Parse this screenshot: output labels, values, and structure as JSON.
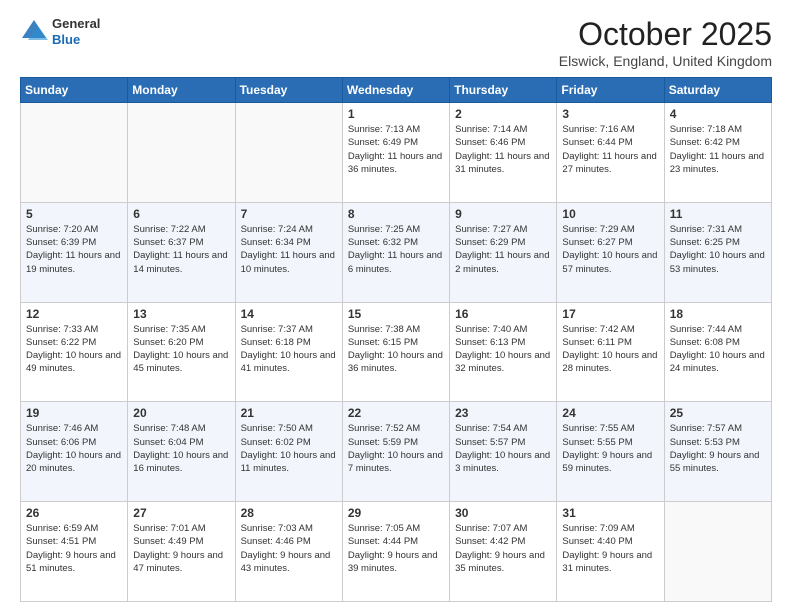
{
  "header": {
    "logo": {
      "general": "General",
      "blue": "Blue"
    },
    "title": "October 2025",
    "location": "Elswick, England, United Kingdom"
  },
  "days_of_week": [
    "Sunday",
    "Monday",
    "Tuesday",
    "Wednesday",
    "Thursday",
    "Friday",
    "Saturday"
  ],
  "weeks": [
    [
      {
        "day": "",
        "info": ""
      },
      {
        "day": "",
        "info": ""
      },
      {
        "day": "",
        "info": ""
      },
      {
        "day": "1",
        "info": "Sunrise: 7:13 AM\nSunset: 6:49 PM\nDaylight: 11 hours and 36 minutes."
      },
      {
        "day": "2",
        "info": "Sunrise: 7:14 AM\nSunset: 6:46 PM\nDaylight: 11 hours and 31 minutes."
      },
      {
        "day": "3",
        "info": "Sunrise: 7:16 AM\nSunset: 6:44 PM\nDaylight: 11 hours and 27 minutes."
      },
      {
        "day": "4",
        "info": "Sunrise: 7:18 AM\nSunset: 6:42 PM\nDaylight: 11 hours and 23 minutes."
      }
    ],
    [
      {
        "day": "5",
        "info": "Sunrise: 7:20 AM\nSunset: 6:39 PM\nDaylight: 11 hours and 19 minutes."
      },
      {
        "day": "6",
        "info": "Sunrise: 7:22 AM\nSunset: 6:37 PM\nDaylight: 11 hours and 14 minutes."
      },
      {
        "day": "7",
        "info": "Sunrise: 7:24 AM\nSunset: 6:34 PM\nDaylight: 11 hours and 10 minutes."
      },
      {
        "day": "8",
        "info": "Sunrise: 7:25 AM\nSunset: 6:32 PM\nDaylight: 11 hours and 6 minutes."
      },
      {
        "day": "9",
        "info": "Sunrise: 7:27 AM\nSunset: 6:29 PM\nDaylight: 11 hours and 2 minutes."
      },
      {
        "day": "10",
        "info": "Sunrise: 7:29 AM\nSunset: 6:27 PM\nDaylight: 10 hours and 57 minutes."
      },
      {
        "day": "11",
        "info": "Sunrise: 7:31 AM\nSunset: 6:25 PM\nDaylight: 10 hours and 53 minutes."
      }
    ],
    [
      {
        "day": "12",
        "info": "Sunrise: 7:33 AM\nSunset: 6:22 PM\nDaylight: 10 hours and 49 minutes."
      },
      {
        "day": "13",
        "info": "Sunrise: 7:35 AM\nSunset: 6:20 PM\nDaylight: 10 hours and 45 minutes."
      },
      {
        "day": "14",
        "info": "Sunrise: 7:37 AM\nSunset: 6:18 PM\nDaylight: 10 hours and 41 minutes."
      },
      {
        "day": "15",
        "info": "Sunrise: 7:38 AM\nSunset: 6:15 PM\nDaylight: 10 hours and 36 minutes."
      },
      {
        "day": "16",
        "info": "Sunrise: 7:40 AM\nSunset: 6:13 PM\nDaylight: 10 hours and 32 minutes."
      },
      {
        "day": "17",
        "info": "Sunrise: 7:42 AM\nSunset: 6:11 PM\nDaylight: 10 hours and 28 minutes."
      },
      {
        "day": "18",
        "info": "Sunrise: 7:44 AM\nSunset: 6:08 PM\nDaylight: 10 hours and 24 minutes."
      }
    ],
    [
      {
        "day": "19",
        "info": "Sunrise: 7:46 AM\nSunset: 6:06 PM\nDaylight: 10 hours and 20 minutes."
      },
      {
        "day": "20",
        "info": "Sunrise: 7:48 AM\nSunset: 6:04 PM\nDaylight: 10 hours and 16 minutes."
      },
      {
        "day": "21",
        "info": "Sunrise: 7:50 AM\nSunset: 6:02 PM\nDaylight: 10 hours and 11 minutes."
      },
      {
        "day": "22",
        "info": "Sunrise: 7:52 AM\nSunset: 5:59 PM\nDaylight: 10 hours and 7 minutes."
      },
      {
        "day": "23",
        "info": "Sunrise: 7:54 AM\nSunset: 5:57 PM\nDaylight: 10 hours and 3 minutes."
      },
      {
        "day": "24",
        "info": "Sunrise: 7:55 AM\nSunset: 5:55 PM\nDaylight: 9 hours and 59 minutes."
      },
      {
        "day": "25",
        "info": "Sunrise: 7:57 AM\nSunset: 5:53 PM\nDaylight: 9 hours and 55 minutes."
      }
    ],
    [
      {
        "day": "26",
        "info": "Sunrise: 6:59 AM\nSunset: 4:51 PM\nDaylight: 9 hours and 51 minutes."
      },
      {
        "day": "27",
        "info": "Sunrise: 7:01 AM\nSunset: 4:49 PM\nDaylight: 9 hours and 47 minutes."
      },
      {
        "day": "28",
        "info": "Sunrise: 7:03 AM\nSunset: 4:46 PM\nDaylight: 9 hours and 43 minutes."
      },
      {
        "day": "29",
        "info": "Sunrise: 7:05 AM\nSunset: 4:44 PM\nDaylight: 9 hours and 39 minutes."
      },
      {
        "day": "30",
        "info": "Sunrise: 7:07 AM\nSunset: 4:42 PM\nDaylight: 9 hours and 35 minutes."
      },
      {
        "day": "31",
        "info": "Sunrise: 7:09 AM\nSunset: 4:40 PM\nDaylight: 9 hours and 31 minutes."
      },
      {
        "day": "",
        "info": ""
      }
    ]
  ]
}
